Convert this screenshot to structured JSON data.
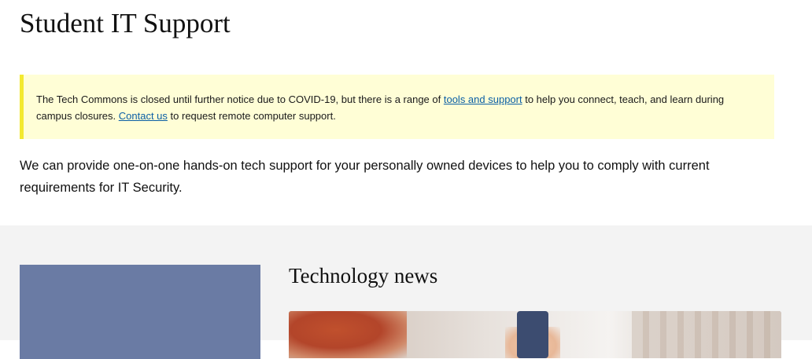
{
  "page": {
    "title": "Student IT Support"
  },
  "notice": {
    "text_before_link1": "The Tech Commons is closed until further notice due to COVID-19, but there is a range of ",
    "link1_label": "tools and support",
    "text_between_links": " to help you connect, teach, and learn during campus closures. ",
    "link2_label": "Contact us",
    "text_after_link2": " to request remote computer support.",
    "background_color": "#fffed6",
    "border_color": "#f3e930"
  },
  "intro": {
    "text": "We can provide one-on-one hands-on tech support for your personally owned devices to help you to comply with current requirements for IT Security."
  },
  "news": {
    "heading": "Technology news",
    "image_semantic": "person-with-phone-photo"
  },
  "colors": {
    "link": "#0b5fa5",
    "lower_section_bg": "#f3f3f3",
    "side_block": "#6a7ba4"
  }
}
